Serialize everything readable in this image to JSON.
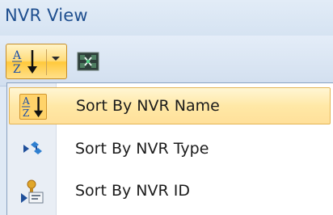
{
  "panel": {
    "title": "NVR View"
  },
  "toolbar": {
    "sort_button": {
      "icon": "sort-az-icon",
      "dropdown_icon": "chevron-down-icon",
      "accent": "#ffd36a"
    },
    "second_button": {
      "icon": "network-device-icon"
    }
  },
  "sort_menu": {
    "items": [
      {
        "label": "Sort By NVR Name",
        "icon": "sort-az-icon",
        "highlighted": true
      },
      {
        "label": "Sort By NVR Type",
        "icon": "type-sort-icon",
        "highlighted": false
      },
      {
        "label": "Sort By NVR ID",
        "icon": "id-sort-icon",
        "highlighted": false
      }
    ]
  },
  "colors": {
    "title_text": "#1f4f8f",
    "highlight": "#ffe8a6",
    "background": "#dfe9f5"
  }
}
